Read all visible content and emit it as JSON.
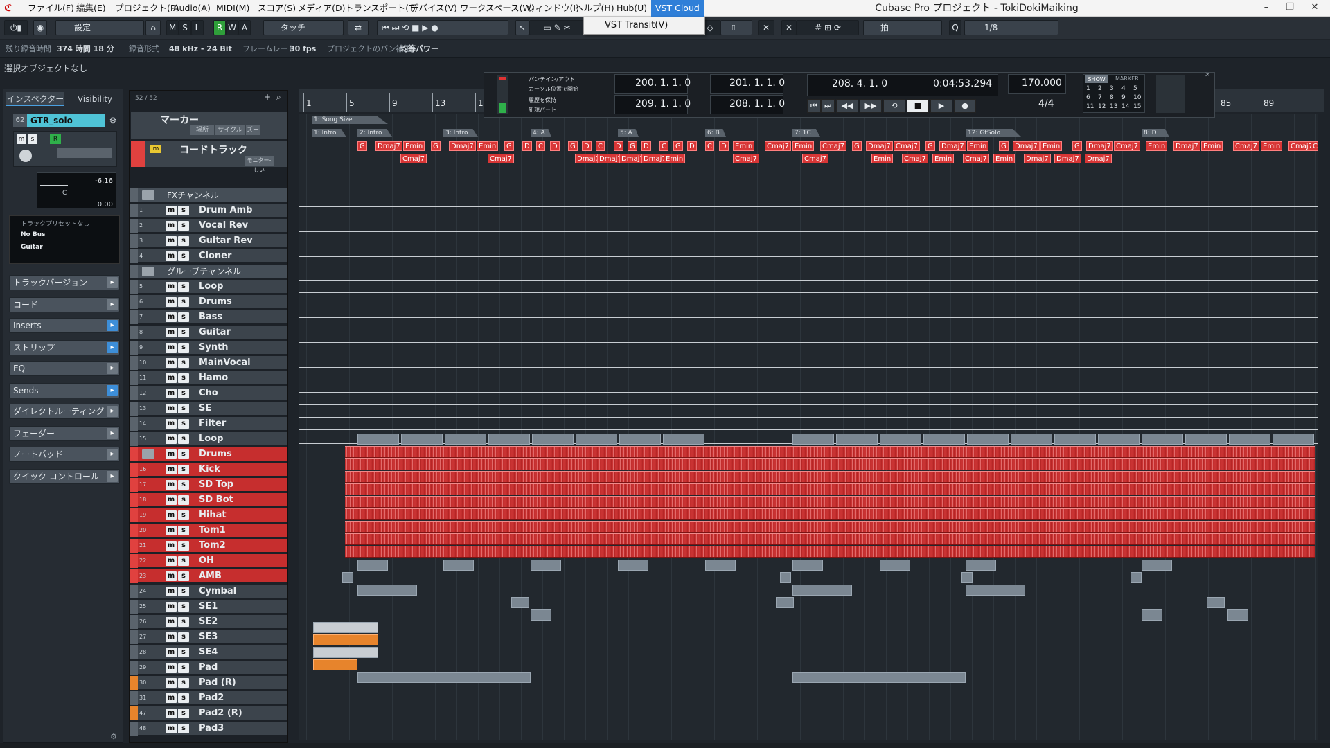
{
  "title": "Cubase Pro プロジェクト - TokiDokiMaiking",
  "menu": [
    "ファイル(F)",
    "編集(E)",
    "プロジェクト(P)",
    "Audio(A)",
    "MIDI(M)",
    "スコア(S)",
    "メディア(D)",
    "トランスポート(T)",
    "デバイス(V)",
    "ワークスペース(W)",
    "ウィンドウ(I)",
    "ヘルプ(H)",
    "Hub(U)",
    "VST Cloud"
  ],
  "dropdown": "VST Transit(V)",
  "toolbar": {
    "preset": "設定",
    "mode_m": "M",
    "mode_s": "S",
    "mode_l": "L",
    "mode_r": "R",
    "mode_w": "W",
    "mode_a": "A",
    "automation": "タッチ",
    "snap": "拍",
    "quantize": "1/8"
  },
  "info": {
    "remaining_label": "残り録音時間",
    "remaining": "374 時間 18 分",
    "format_label": "録音形式",
    "format": "48 kHz - 24 Bit",
    "framerate_label": "フレームレート",
    "framerate": "30 fps",
    "pan_label": "プロジェクトのパン補正",
    "pan": "均等パワー"
  },
  "selection": "選択オブジェクトなし",
  "inspector": {
    "tab1": "インスペクター",
    "tab2": "Visibility",
    "track": "GTR_solo",
    "tracknum": "62",
    "volume": "-6.16",
    "pan": "C",
    "send": "0.00",
    "preset": "トラックプリセットなし",
    "bus": "No Bus",
    "output": "Guitar",
    "sections": [
      "トラックバージョン",
      "コード",
      "Inserts",
      "ストリップ",
      "EQ",
      "Sends",
      "ダイレクトルーティング",
      "フェーダー",
      "ノートパッド",
      "クイック コントロール"
    ]
  },
  "tracklist": {
    "count": "52 / 52",
    "marker_track": "マーカー",
    "marker_buttons": [
      "場所",
      "サイクル",
      "ズー"
    ],
    "chord_track": "コードトラック",
    "chord_btn": "モニター-しい"
  },
  "tracks": [
    {
      "n": "",
      "name": "FXチャンネル",
      "type": "folder"
    },
    {
      "n": "1",
      "name": "Drum Amb",
      "type": "fx"
    },
    {
      "n": "2",
      "name": "Vocal Rev",
      "type": "fx"
    },
    {
      "n": "3",
      "name": "Guitar Rev",
      "type": "fx"
    },
    {
      "n": "4",
      "name": "Cloner",
      "type": "fx"
    },
    {
      "n": "",
      "name": "グループチャンネル",
      "type": "folder"
    },
    {
      "n": "5",
      "name": "Loop",
      "type": "grp"
    },
    {
      "n": "6",
      "name": "Drums",
      "type": "grp"
    },
    {
      "n": "7",
      "name": "Bass",
      "type": "grp"
    },
    {
      "n": "8",
      "name": "Guitar",
      "type": "grp"
    },
    {
      "n": "9",
      "name": "Synth",
      "type": "grp"
    },
    {
      "n": "10",
      "name": "MainVocal",
      "type": "grp"
    },
    {
      "n": "11",
      "name": "Hamo",
      "type": "grp"
    },
    {
      "n": "12",
      "name": "Cho",
      "type": "grp"
    },
    {
      "n": "13",
      "name": "SE",
      "type": "grp"
    },
    {
      "n": "14",
      "name": "Filter",
      "type": "grp"
    },
    {
      "n": "15",
      "name": "Loop",
      "type": "audio"
    },
    {
      "n": "",
      "name": "Drums",
      "type": "redfolder"
    },
    {
      "n": "16",
      "name": "Kick",
      "type": "red"
    },
    {
      "n": "17",
      "name": "SD Top",
      "type": "red"
    },
    {
      "n": "18",
      "name": "SD Bot",
      "type": "red"
    },
    {
      "n": "19",
      "name": "Hihat",
      "type": "red"
    },
    {
      "n": "20",
      "name": "Tom1",
      "type": "red"
    },
    {
      "n": "21",
      "name": "Tom2",
      "type": "red"
    },
    {
      "n": "22",
      "name": "OH",
      "type": "red"
    },
    {
      "n": "23",
      "name": "AMB",
      "type": "red"
    },
    {
      "n": "24",
      "name": "Cymbal",
      "type": "audio"
    },
    {
      "n": "25",
      "name": "SE1",
      "type": "audio"
    },
    {
      "n": "26",
      "name": "SE2",
      "type": "audio"
    },
    {
      "n": "27",
      "name": "SE3",
      "type": "audio"
    },
    {
      "n": "28",
      "name": "SE4",
      "type": "audio"
    },
    {
      "n": "29",
      "name": "Pad",
      "type": "inst"
    },
    {
      "n": "30",
      "name": "Pad (R)",
      "type": "orange"
    },
    {
      "n": "31",
      "name": "Pad2",
      "type": "inst"
    },
    {
      "n": "47",
      "name": "Pad2 (R)",
      "type": "orange"
    },
    {
      "n": "48",
      "name": "Pad3",
      "type": "inst"
    }
  ],
  "ruler": [
    "1",
    "5",
    "9",
    "13",
    "1",
    "85",
    "89"
  ],
  "markers": [
    "1: Song Size",
    "1: Intro",
    "2: Intro",
    "3: Intro",
    "4: A",
    "5: A",
    "6: B",
    "7: 1C",
    "12: GtSolo",
    "8: D"
  ],
  "chords": [
    "G",
    "Dmaj7",
    "Emin",
    "G",
    "Dmaj7",
    "Emin",
    "G",
    "D",
    "C",
    "D",
    "G",
    "D",
    "C",
    "D",
    "G",
    "D",
    "C",
    "G",
    "D",
    "C",
    "D",
    "Emin",
    "Cmaj7",
    "Emin",
    "Cmaj7",
    "G",
    "Dmaj7",
    "Cmaj7",
    "G",
    "Dmaj7",
    "Emin",
    "G",
    "Dmaj7",
    "Emin",
    "G",
    "Dmaj7",
    "Cmaj7",
    "Emin",
    "Dmaj7",
    "Emin",
    "Cmaj7",
    "Emin",
    "Cmaj7",
    "Emin",
    "Cmaj7"
  ],
  "chords2": [
    "Cmaj7",
    "Cmaj7",
    "Dmaj7",
    "Dmaj7",
    "Dmaj7",
    "Dmaj7",
    "Emin",
    "Cmaj7",
    "Cmaj7",
    "Emin",
    "Cmaj7",
    "Emin",
    "Cmaj7",
    "Emin",
    "Dmaj7",
    "Dmaj7",
    "Dmaj7"
  ],
  "transport": {
    "punch": "パンチイン/アウト",
    "cursor": "カーソル位置で開始",
    "keep": "履歴を保持",
    "new": "新規パート",
    "left1": "200. 1. 1.  0",
    "left2": "209. 1. 1.  0",
    "right1": "201. 1. 1.  0",
    "right2": "208. 1. 1.  0",
    "pos_bars": "208. 4. 1.  0",
    "pos_time": "0:04:53.294",
    "tempo": "170.000",
    "sig": "4/4",
    "show": "SHOW",
    "marker": "MARKER",
    "markers_nums": [
      "1",
      "2",
      "3",
      "4",
      "5",
      "6",
      "7",
      "8",
      "9",
      "10",
      "11",
      "12",
      "13",
      "14",
      "15"
    ]
  }
}
